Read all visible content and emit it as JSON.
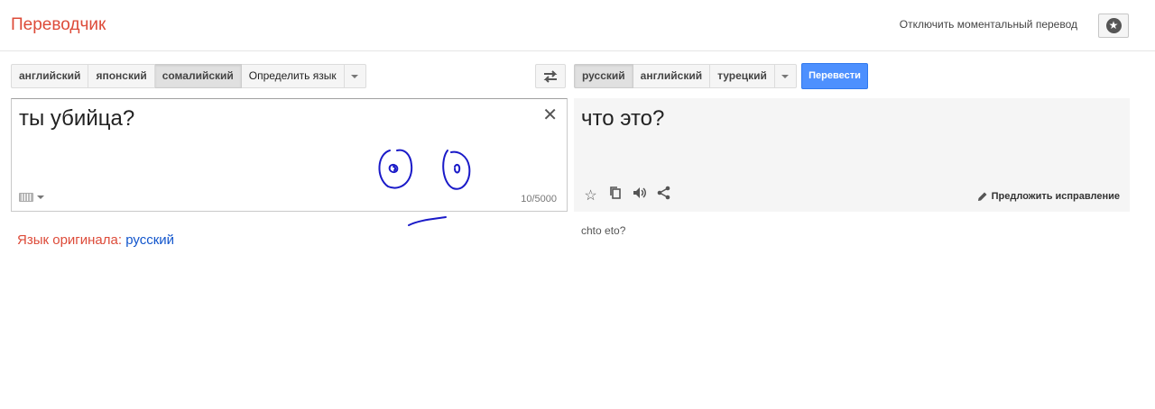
{
  "header": {
    "title": "Переводчик",
    "instant_toggle": "Отключить моментальный перевод"
  },
  "source": {
    "languages": [
      "английский",
      "японский",
      "сомалийский",
      "Определить язык"
    ],
    "selected_index": 2,
    "text": "ты убийца?",
    "counter": "10/5000"
  },
  "target": {
    "languages": [
      "русский",
      "английский",
      "турецкий"
    ],
    "selected_index": 0,
    "text": "что это?",
    "transliteration": "chto eto?",
    "suggest": "Предложить исправление"
  },
  "translate_button": "Перевести",
  "detected": {
    "prefix": "Язык оригинала:",
    "language": "русский"
  },
  "icons": [
    "star-icon",
    "swap-icon",
    "close-icon",
    "keyboard-icon",
    "favorite-icon",
    "copy-icon",
    "speaker-icon",
    "share-icon",
    "pencil-icon"
  ],
  "colors": {
    "brand": "#dd4b39",
    "accent": "#4d90fe",
    "link": "#1155cc",
    "doodle": "#1a1ac8"
  }
}
